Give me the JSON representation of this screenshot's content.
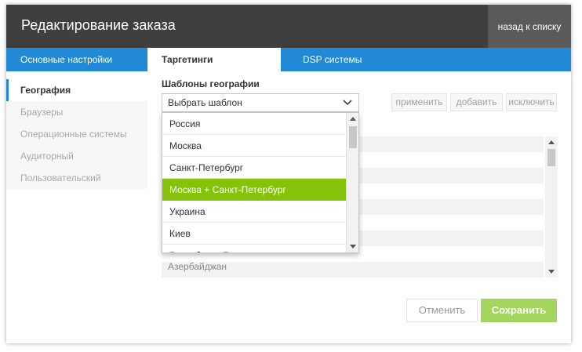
{
  "header": {
    "title": "Редактирование заказа",
    "back_label": "назад к списку"
  },
  "tabs": [
    {
      "label": "Основные настройки",
      "active": false
    },
    {
      "label": "Таргетинги",
      "active": true
    },
    {
      "label": "DSP системы",
      "active": false
    }
  ],
  "sidebar": {
    "items": [
      {
        "label": "География",
        "active": true
      },
      {
        "label": "Браузеры",
        "active": false
      },
      {
        "label": "Операционные системы",
        "active": false
      },
      {
        "label": "Аудиторный",
        "active": false
      },
      {
        "label": "Пользовательский",
        "active": false
      }
    ]
  },
  "geo": {
    "templates_label": "Шаблоны географии",
    "select_placeholder": "Выбрать шаблон",
    "apply_label": "применить",
    "add_label": "добавить",
    "exclude_label": "исключить",
    "dropdown_options": [
      "Россия",
      "Москва",
      "Санкт-Петербург",
      "Москва + Санкт-Петербург",
      "Украина",
      "Киев",
      "Республика Беларусь"
    ],
    "selected_option": "Москва + Санкт-Петербург",
    "list_visible_item": "Азербайджан"
  },
  "footer": {
    "cancel_label": "Отменить",
    "save_label": "Сохранить"
  },
  "colors": {
    "accent": "#2189d6",
    "header_bg": "#3f3f3f",
    "selected": "#84c30a",
    "save": "#a3d55f"
  }
}
